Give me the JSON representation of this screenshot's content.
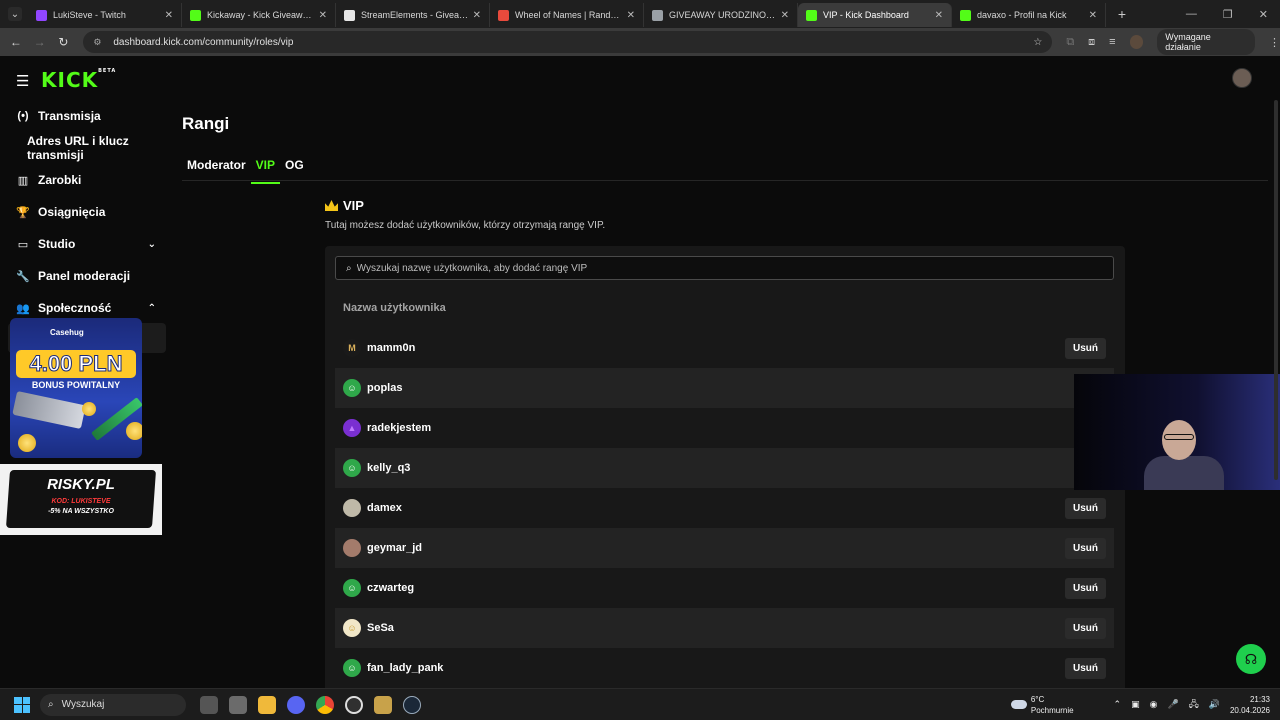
{
  "browser": {
    "tabs": [
      {
        "title": "LukiSteve - Twitch",
        "color": "#9146ff",
        "active": false
      },
      {
        "title": "Kickaway - Kick Giveaway Tool",
        "color": "#53fc18",
        "active": false
      },
      {
        "title": "StreamElements - Giveaways",
        "color": "#e6e6e6",
        "active": false
      },
      {
        "title": "Wheel of Names | Random nam",
        "color": "#e84a3c",
        "active": false
      },
      {
        "title": "GIVEAWAY URODZINOWY",
        "color": "#9aa0a6",
        "active": false
      },
      {
        "title": "VIP - Kick Dashboard",
        "color": "#53fc18",
        "active": true
      },
      {
        "title": "davaxo - Profil na Kick",
        "color": "#53fc18",
        "active": false
      }
    ],
    "url": "dashboard.kick.com/community/roles/vip",
    "required_action": "Wymagane działanie"
  },
  "sidebar": {
    "items": [
      {
        "label": "Transmisja",
        "icon": "(•)"
      },
      {
        "label": "Adres URL i klucz transmisji",
        "icon": ""
      },
      {
        "label": "Zarobki",
        "icon": "▥"
      },
      {
        "label": "Osiągnięcia",
        "icon": "🏆"
      },
      {
        "label": "Studio",
        "icon": "▭"
      },
      {
        "label": "Panel moderacji",
        "icon": "🔧"
      },
      {
        "label": "Społeczność",
        "icon": "👥"
      }
    ]
  },
  "promos": {
    "casehug_brand": "Casehug",
    "casehug_amount": "4.00 PLN",
    "casehug_bonus": "BONUS POWITALNY",
    "risky_brand": "RISKY.PL",
    "risky_code": "KOD: LUKISTEVE",
    "risky_discount": "-5% NA WSZYSTKO"
  },
  "page": {
    "title": "Rangi",
    "tabs": [
      "Moderator",
      "VIP",
      "OG"
    ],
    "section_title": "VIP",
    "description": "Tutaj możesz dodać użytkowników, którzy otrzymają rangę VIP.",
    "search_placeholder": "Wyszukaj nazwę użytkownika, aby dodać rangę VIP",
    "column_header": "Nazwa użytkownika",
    "remove_label": "Usuń",
    "users": [
      {
        "name": "mamm0n",
        "avatar": "#1a1a1a",
        "glyph": "M",
        "glyph_color": "#d9b05b"
      },
      {
        "name": "poplas",
        "avatar": "#2fa84a",
        "glyph": "☺",
        "glyph_color": "#fff"
      },
      {
        "name": "radekjestem",
        "avatar": "#7a2fd1",
        "glyph": "▲",
        "glyph_color": "#c07aff"
      },
      {
        "name": "kelly_q3",
        "avatar": "#2fa84a",
        "glyph": "☺",
        "glyph_color": "#fff"
      },
      {
        "name": "damex",
        "avatar": "#bfb9a8",
        "glyph": "",
        "glyph_color": "#fff"
      },
      {
        "name": "geymar_jd",
        "avatar": "#a37b6b",
        "glyph": "",
        "glyph_color": "#fff"
      },
      {
        "name": "czwarteg",
        "avatar": "#2fa84a",
        "glyph": "☺",
        "glyph_color": "#fff"
      },
      {
        "name": "SeSa",
        "avatar": "#f1e7c8",
        "glyph": "☺",
        "glyph_color": "#c79b2b"
      },
      {
        "name": "fan_lady_pank",
        "avatar": "#2fa84a",
        "glyph": "☺",
        "glyph_color": "#fff"
      }
    ]
  },
  "taskbar": {
    "search": "Wyszukaj",
    "temperature": "6°C",
    "weather": "Pochmurnie",
    "time": "21:33",
    "date": "20.04.2026"
  }
}
